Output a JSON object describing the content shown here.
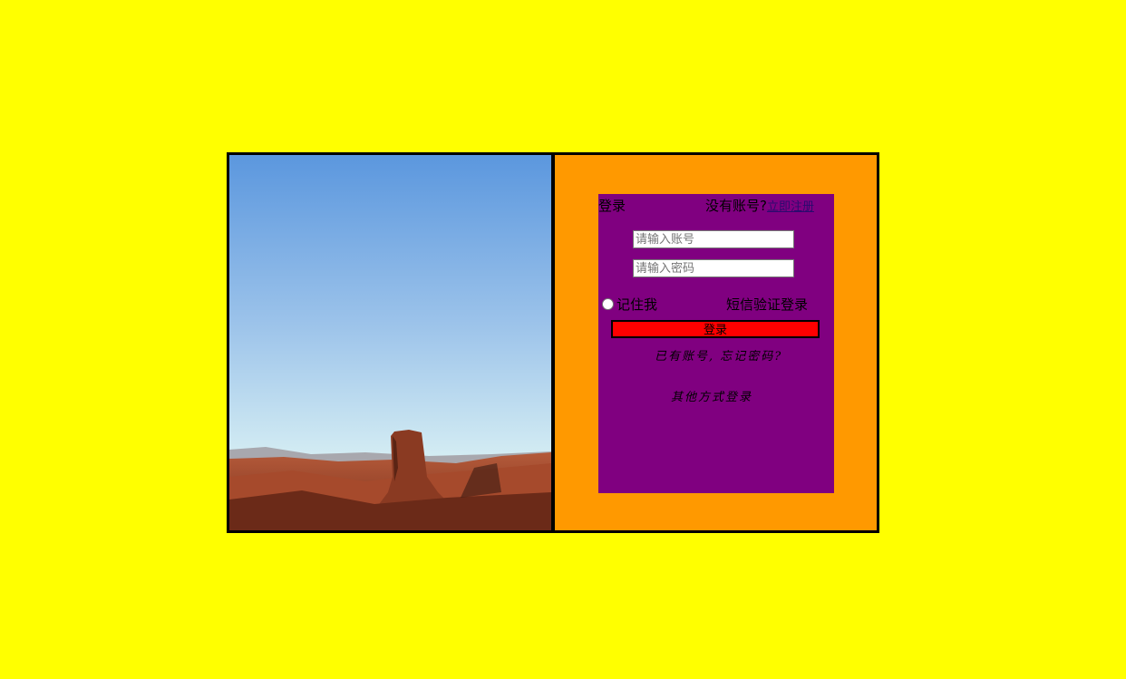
{
  "hero_image": {
    "icon": "desert-butte-landscape-image"
  },
  "header": {
    "title": "登录",
    "no_account_text": "没有账号?",
    "register_link": "立即注册"
  },
  "form": {
    "account_placeholder": "请输入账号",
    "password_placeholder": "请输入密码",
    "remember_label": "记住我",
    "sms_login": "短信验证登录",
    "login_button": "登录",
    "forgot_text": "已有账号, 忘记密码?",
    "other_login": "其他方式登录"
  },
  "colors": {
    "page_bg": "#ffff00",
    "right_bg": "#ff9900",
    "panel_bg": "#800080",
    "button_bg": "#ff0000"
  }
}
